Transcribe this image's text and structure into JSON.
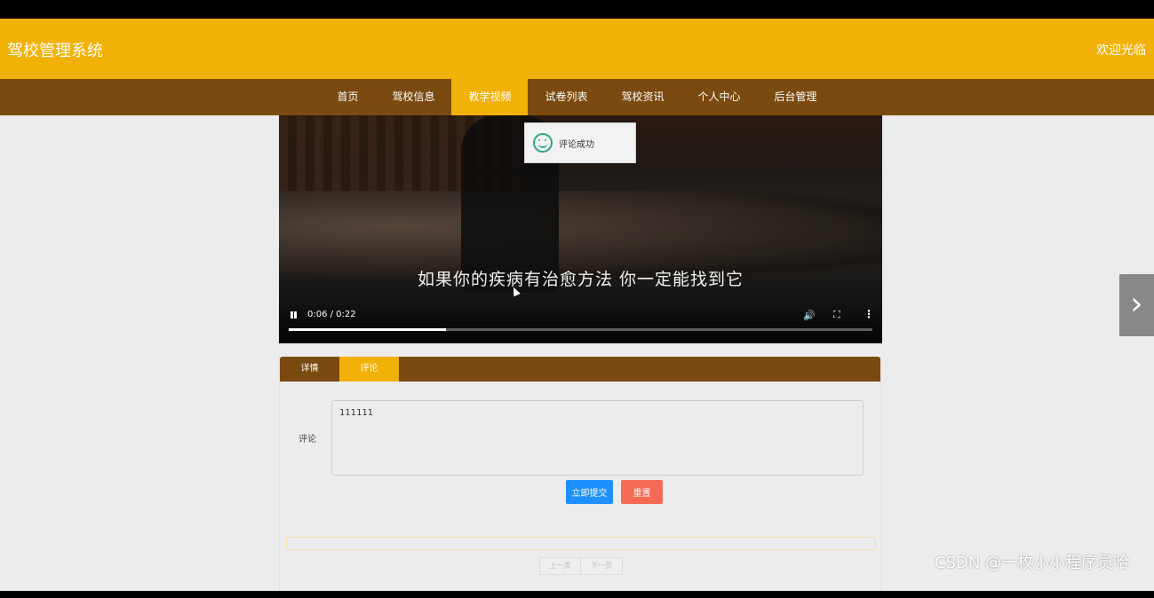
{
  "header": {
    "site_title": "驾校管理系统",
    "welcome": "欢迎光临"
  },
  "nav": {
    "items": [
      {
        "label": "首页"
      },
      {
        "label": "驾校信息"
      },
      {
        "label": "教学视频",
        "active": true
      },
      {
        "label": "试卷列表"
      },
      {
        "label": "驾校资讯"
      },
      {
        "label": "个人中心"
      },
      {
        "label": "后台管理"
      }
    ]
  },
  "video": {
    "subtitle": "如果你的疾病有治愈方法 你一定能找到它",
    "time": "0:06 / 0:22",
    "progress": 0.27
  },
  "toast": {
    "message": "评论成功"
  },
  "tabs": [
    {
      "label": "详情"
    },
    {
      "label": "评论",
      "active": true
    }
  ],
  "comment_form": {
    "label": "评论",
    "value": "111111",
    "submit_label": "立即提交",
    "reset_label": "重置"
  },
  "pager": {
    "prev_label": "上一页",
    "next_label": "下一页"
  },
  "watermark": "CSDN @一枚小小程序员哈"
}
